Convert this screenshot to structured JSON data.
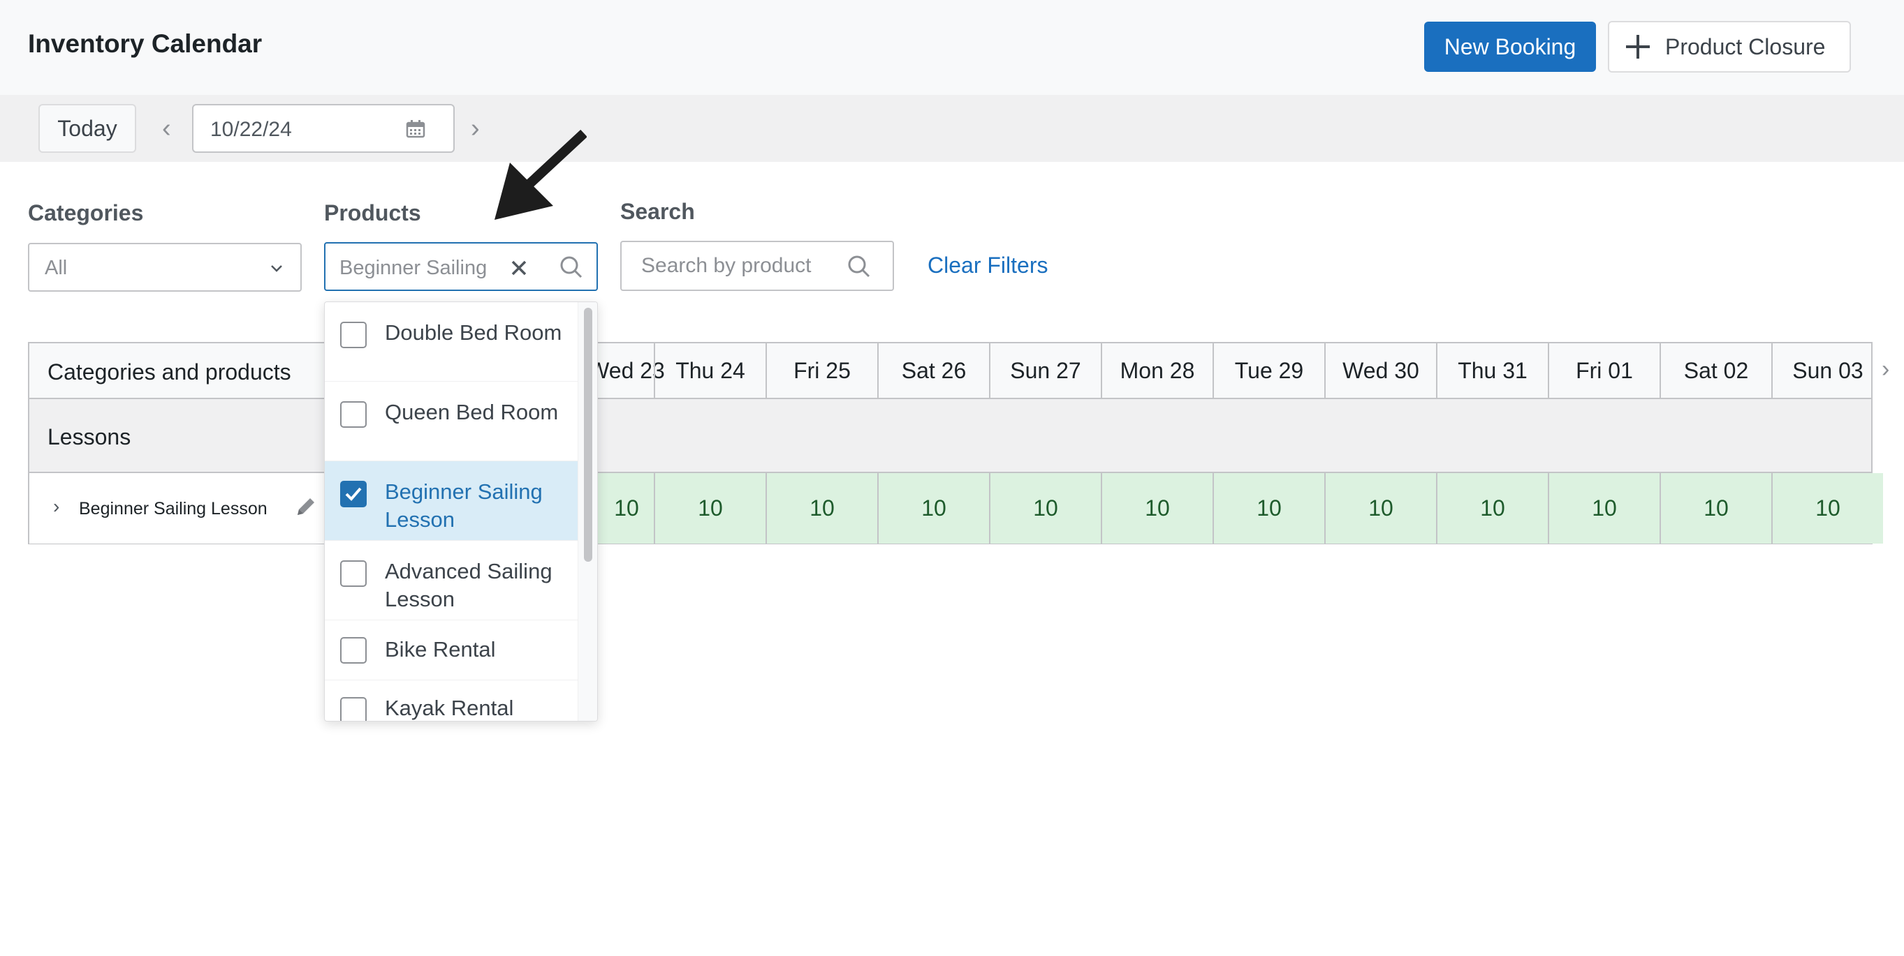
{
  "header": {
    "title": "Inventory Calendar",
    "new_booking_label": "New Booking",
    "product_closure_label": "Product Closure"
  },
  "datebar": {
    "today_label": "Today",
    "prev_arrow": "‹",
    "next_arrow": "›",
    "date_value": "10/22/24"
  },
  "filters": {
    "categories_label": "Categories",
    "categories_value": "All",
    "products_label": "Products",
    "products_value": "Beginner Sailing",
    "search_label": "Search",
    "search_placeholder": "Search by product",
    "clear_filters_label": "Clear Filters"
  },
  "grid": {
    "header_title": "Categories and products",
    "days": [
      "Wed 23",
      "Thu 24",
      "Fri 25",
      "Sat 26",
      "Sun 27",
      "Mon 28",
      "Tue 29",
      "Wed 30",
      "Thu 31",
      "Fri 01",
      "Sat 02",
      "Sun 03"
    ],
    "category": "Lessons",
    "product_chevron": "›",
    "product_name": "Beginner Sailing Lesson",
    "availability": [
      "10",
      "10",
      "10",
      "10",
      "10",
      "10",
      "10",
      "10",
      "10",
      "10",
      "10",
      "10"
    ],
    "scroll_next": "›"
  },
  "dropdown": {
    "options": [
      {
        "label": "Double Bed Room",
        "checked": false
      },
      {
        "label": "Queen Bed Room",
        "checked": false
      },
      {
        "label": "Beginner Sailing Lesson",
        "checked": true
      },
      {
        "label": "Advanced Sailing Lesson",
        "checked": false
      },
      {
        "label": "Bike Rental",
        "checked": false
      },
      {
        "label": "Kayak Rental",
        "checked": false
      }
    ]
  },
  "colors": {
    "primary": "#1a6fbf",
    "focus_border": "#2271b1",
    "availability_bg": "#dcf2e0",
    "availability_text": "#1e5b2c",
    "selected_option_bg": "#d9ecf7"
  }
}
